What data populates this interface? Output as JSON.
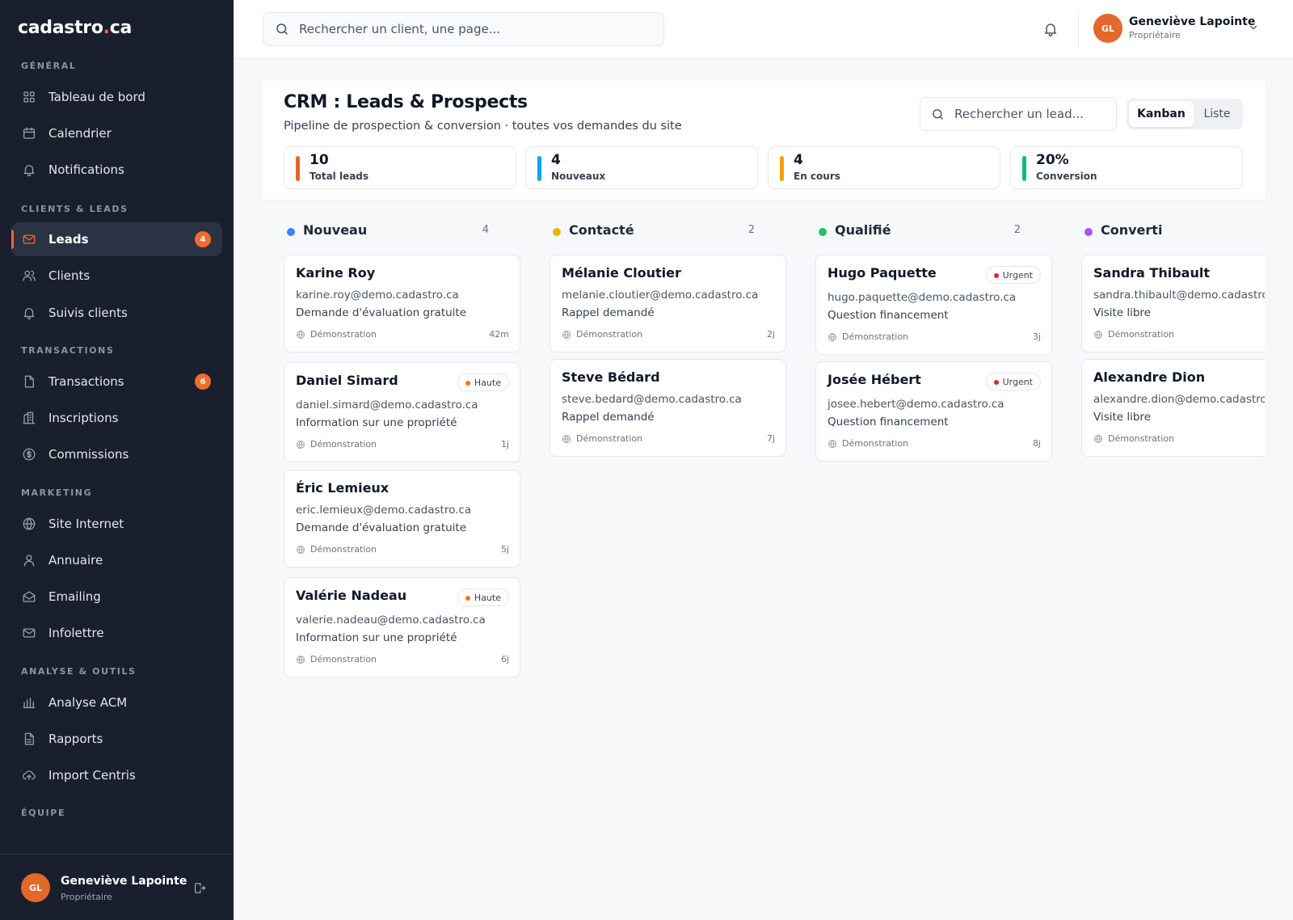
{
  "app": {
    "logo_main": "cadastro",
    "logo_dot": ".",
    "logo_tld": "ca"
  },
  "colors": {
    "accent": "#f26b2a",
    "sidebar_bg": "#1a1f2e",
    "urgent": "#dc2626",
    "haute": "#f97316"
  },
  "sidebar": {
    "sections": [
      {
        "label": "GÉNÉRAL",
        "items": [
          {
            "label": "Tableau de bord",
            "icon": "grid-icon"
          },
          {
            "label": "Calendrier",
            "icon": "calendar-icon"
          },
          {
            "label": "Notifications",
            "icon": "bell-icon"
          }
        ]
      },
      {
        "label": "CLIENTS & LEADS",
        "items": [
          {
            "label": "Leads",
            "icon": "mail-icon",
            "badge": "4",
            "active": true
          },
          {
            "label": "Clients",
            "icon": "users-icon"
          },
          {
            "label": "Suivis clients",
            "icon": "bell-icon"
          }
        ]
      },
      {
        "label": "TRANSACTIONS",
        "items": [
          {
            "label": "Transactions",
            "icon": "file-icon",
            "badge": "6"
          },
          {
            "label": "Inscriptions",
            "icon": "building-icon"
          },
          {
            "label": "Commissions",
            "icon": "dollar-icon"
          }
        ]
      },
      {
        "label": "MARKETING",
        "items": [
          {
            "label": "Site Internet",
            "icon": "globe-icon"
          },
          {
            "label": "Annuaire",
            "icon": "user-icon"
          },
          {
            "label": "Emailing",
            "icon": "envelope-open-icon"
          },
          {
            "label": "Infolettre",
            "icon": "mail-icon"
          }
        ]
      },
      {
        "label": "ANALYSE & OUTILS",
        "items": [
          {
            "label": "Analyse ACM",
            "icon": "bar-chart-icon"
          },
          {
            "label": "Rapports",
            "icon": "report-icon"
          },
          {
            "label": "Import Centris",
            "icon": "cloud-upload-icon"
          }
        ]
      },
      {
        "label": "ÉQUIPE",
        "items": []
      }
    ],
    "user": {
      "initials": "GL",
      "name": "Geneviève Lapointe",
      "role": "Propriétaire"
    }
  },
  "topbar": {
    "search_placeholder": "Rechercher un client, une page...",
    "user": {
      "initials": "GL",
      "name": "Geneviève Lapointe",
      "role": "Propriétaire"
    }
  },
  "header": {
    "title": "CRM : Leads & Prospects",
    "subtitle": "Pipeline de prospection & conversion · toutes vos demandes du site",
    "search_placeholder": "Rechercher un lead...",
    "views": {
      "kanban": "Kanban",
      "list": "Liste",
      "selected": "Kanban"
    },
    "stats": [
      {
        "value": "10",
        "label": "Total leads",
        "color": "#e8652b"
      },
      {
        "value": "4",
        "label": "Nouveaux",
        "color": "#0ea5e9"
      },
      {
        "value": "4",
        "label": "En cours",
        "color": "#f59e0b"
      },
      {
        "value": "20%",
        "label": "Conversion",
        "color": "#10b981"
      }
    ]
  },
  "board": {
    "columns": [
      {
        "title": "Nouveau",
        "count": "4",
        "color": "#3b82f6",
        "cards": [
          {
            "name": "Karine Roy",
            "email": "karine.roy@demo.cadastro.ca",
            "request": "Demande d'évaluation gratuite",
            "source": "Démonstration",
            "age": "42m",
            "priority": ""
          },
          {
            "name": "Daniel Simard",
            "email": "daniel.simard@demo.cadastro.ca",
            "request": "Information sur une propriété",
            "source": "Démonstration",
            "age": "1j",
            "priority": "Haute"
          },
          {
            "name": "Éric Lemieux",
            "email": "eric.lemieux@demo.cadastro.ca",
            "request": "Demande d'évaluation gratuite",
            "source": "Démonstration",
            "age": "5j",
            "priority": ""
          },
          {
            "name": "Valérie Nadeau",
            "email": "valerie.nadeau@demo.cadastro.ca",
            "request": "Information sur une propriété",
            "source": "Démonstration",
            "age": "6j",
            "priority": "Haute"
          }
        ]
      },
      {
        "title": "Contacté",
        "count": "2",
        "color": "#eab308",
        "cards": [
          {
            "name": "Mélanie Cloutier",
            "email": "melanie.cloutier@demo.cadastro.ca",
            "request": "Rappel demandé",
            "source": "Démonstration",
            "age": "2j",
            "priority": ""
          },
          {
            "name": "Steve Bédard",
            "email": "steve.bedard@demo.cadastro.ca",
            "request": "Rappel demandé",
            "source": "Démonstration",
            "age": "7j",
            "priority": ""
          }
        ]
      },
      {
        "title": "Qualifié",
        "count": "2",
        "color": "#22c55e",
        "cards": [
          {
            "name": "Hugo Paquette",
            "email": "hugo.paquette@demo.cadastro.ca",
            "request": "Question financement",
            "source": "Démonstration",
            "age": "3j",
            "priority": "Urgent"
          },
          {
            "name": "Josée Hébert",
            "email": "josee.hebert@demo.cadastro.ca",
            "request": "Question financement",
            "source": "Démonstration",
            "age": "8j",
            "priority": "Urgent"
          }
        ]
      },
      {
        "title": "Converti",
        "count": "",
        "color": "#a855f7",
        "cards": [
          {
            "name": "Sandra Thibault",
            "email": "sandra.thibault@demo.cadastro.ca",
            "request": "Visite libre",
            "source": "Démonstration",
            "age": "",
            "priority": ""
          },
          {
            "name": "Alexandre Dion",
            "email": "alexandre.dion@demo.cadastro.ca",
            "request": "Visite libre",
            "source": "Démonstration",
            "age": "",
            "priority": ""
          }
        ]
      }
    ]
  }
}
